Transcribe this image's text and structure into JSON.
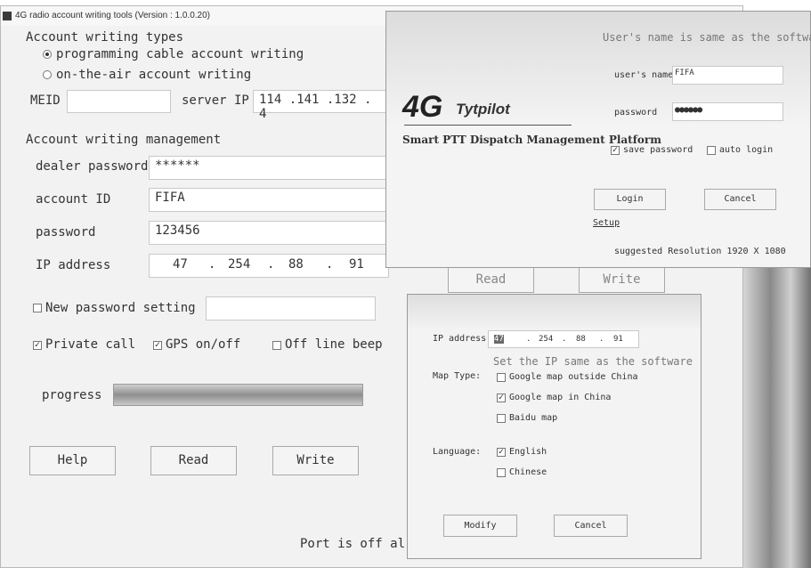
{
  "main": {
    "title": "4G radio account writing tools (Version : 1.0.0.20)",
    "types_group": "Account writing types",
    "radio_programming": "programming cable account writing",
    "radio_ota": "on-the-air account writing",
    "meid_label": "MEID",
    "meid_value": "",
    "server_ip_label": "server IP",
    "server_ip_value": "114 .141 .132 . 4",
    "mgmt_group": "Account writing management",
    "dealer_password_label": "dealer password",
    "dealer_password_value": "******",
    "account_id_label": "account ID",
    "account_id_value": "FIFA",
    "password_label": "password",
    "password_value": "123456",
    "ip_address_label": "IP address",
    "ip_parts": [
      "47",
      ".",
      "254",
      ".",
      "88",
      ".",
      "91"
    ],
    "new_password_label": "New password setting",
    "private_call_label": "Private call",
    "gps_label": "GPS on/off",
    "offline_beep_label": "Off line beep",
    "progress_label": "progress",
    "progress_value": 1.0,
    "help_btn": "Help",
    "read_btn": "Read",
    "write_btn": "Write",
    "read_btn2": "Read",
    "write_btn2": "Write",
    "status_text": "Port is off al"
  },
  "login": {
    "hint": "User's name is same as the software",
    "logo_4g": "4G",
    "logo_brand": "Tytpilot",
    "platform": "Smart PTT Dispatch Management Platform",
    "username_label": "user's name",
    "username_value": "FIFA",
    "password_label": "password",
    "password_value": "●●●●●●",
    "save_password": "save password",
    "auto_login": "auto login",
    "login_btn": "Login",
    "cancel_btn": "Cancel",
    "setup_link": "Setup",
    "resolution": "suggested Resolution 1920 X 1080"
  },
  "mapdlg": {
    "ip_label": "IP address",
    "ip_parts": [
      "47",
      ".",
      "254",
      ".",
      "88",
      ".",
      "91"
    ],
    "ip_hint": "Set the IP same as the software",
    "map_type_label": "Map Type:",
    "map_google_outside": "Google map outside China",
    "map_google_china": "Google map in China",
    "map_baidu": "Baidu map",
    "language_label": "Language:",
    "lang_english": "English",
    "lang_chinese": "Chinese",
    "modify_btn": "Modify",
    "cancel_btn": "Cancel"
  }
}
